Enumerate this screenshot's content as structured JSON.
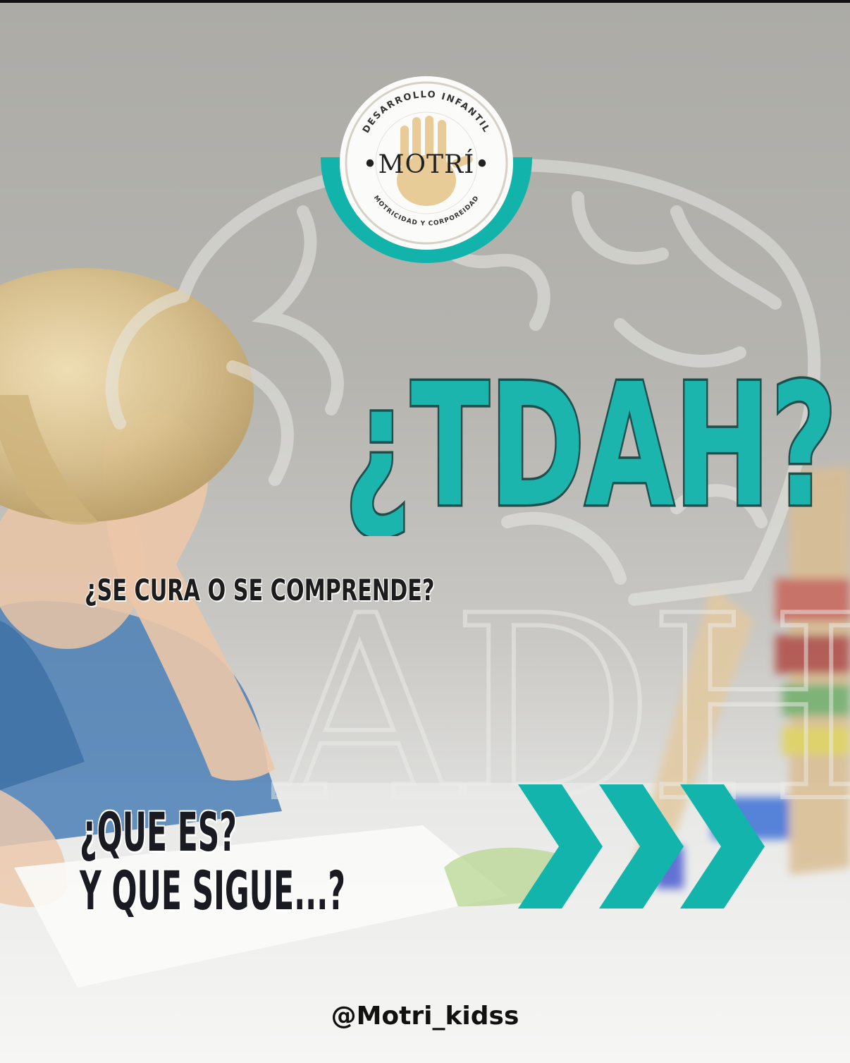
{
  "logo": {
    "top_arc_text": "DESARROLLO INFANTIL",
    "brand_name": "•MOTRÍ•",
    "bottom_arc_text": "MOTRICIDAD Y CORPOREIDAD",
    "accent_color": "#12b3ab"
  },
  "headline": {
    "title": "¿TDAH?",
    "title_fill": "#1bb5ad",
    "title_outline": "#1f4f4d",
    "subtitle": "¿SE CURA O SE COMPRENDE?"
  },
  "questions": {
    "line1": "¿QUE ES?",
    "line2": "Y QUE SIGUE...?"
  },
  "arrows": {
    "icon": "triple-chevron-right-icon",
    "color": "#13b4ab"
  },
  "footer": {
    "handle": "@Motri_kidss"
  },
  "background": {
    "brain_watermark_text": "ADHD"
  }
}
